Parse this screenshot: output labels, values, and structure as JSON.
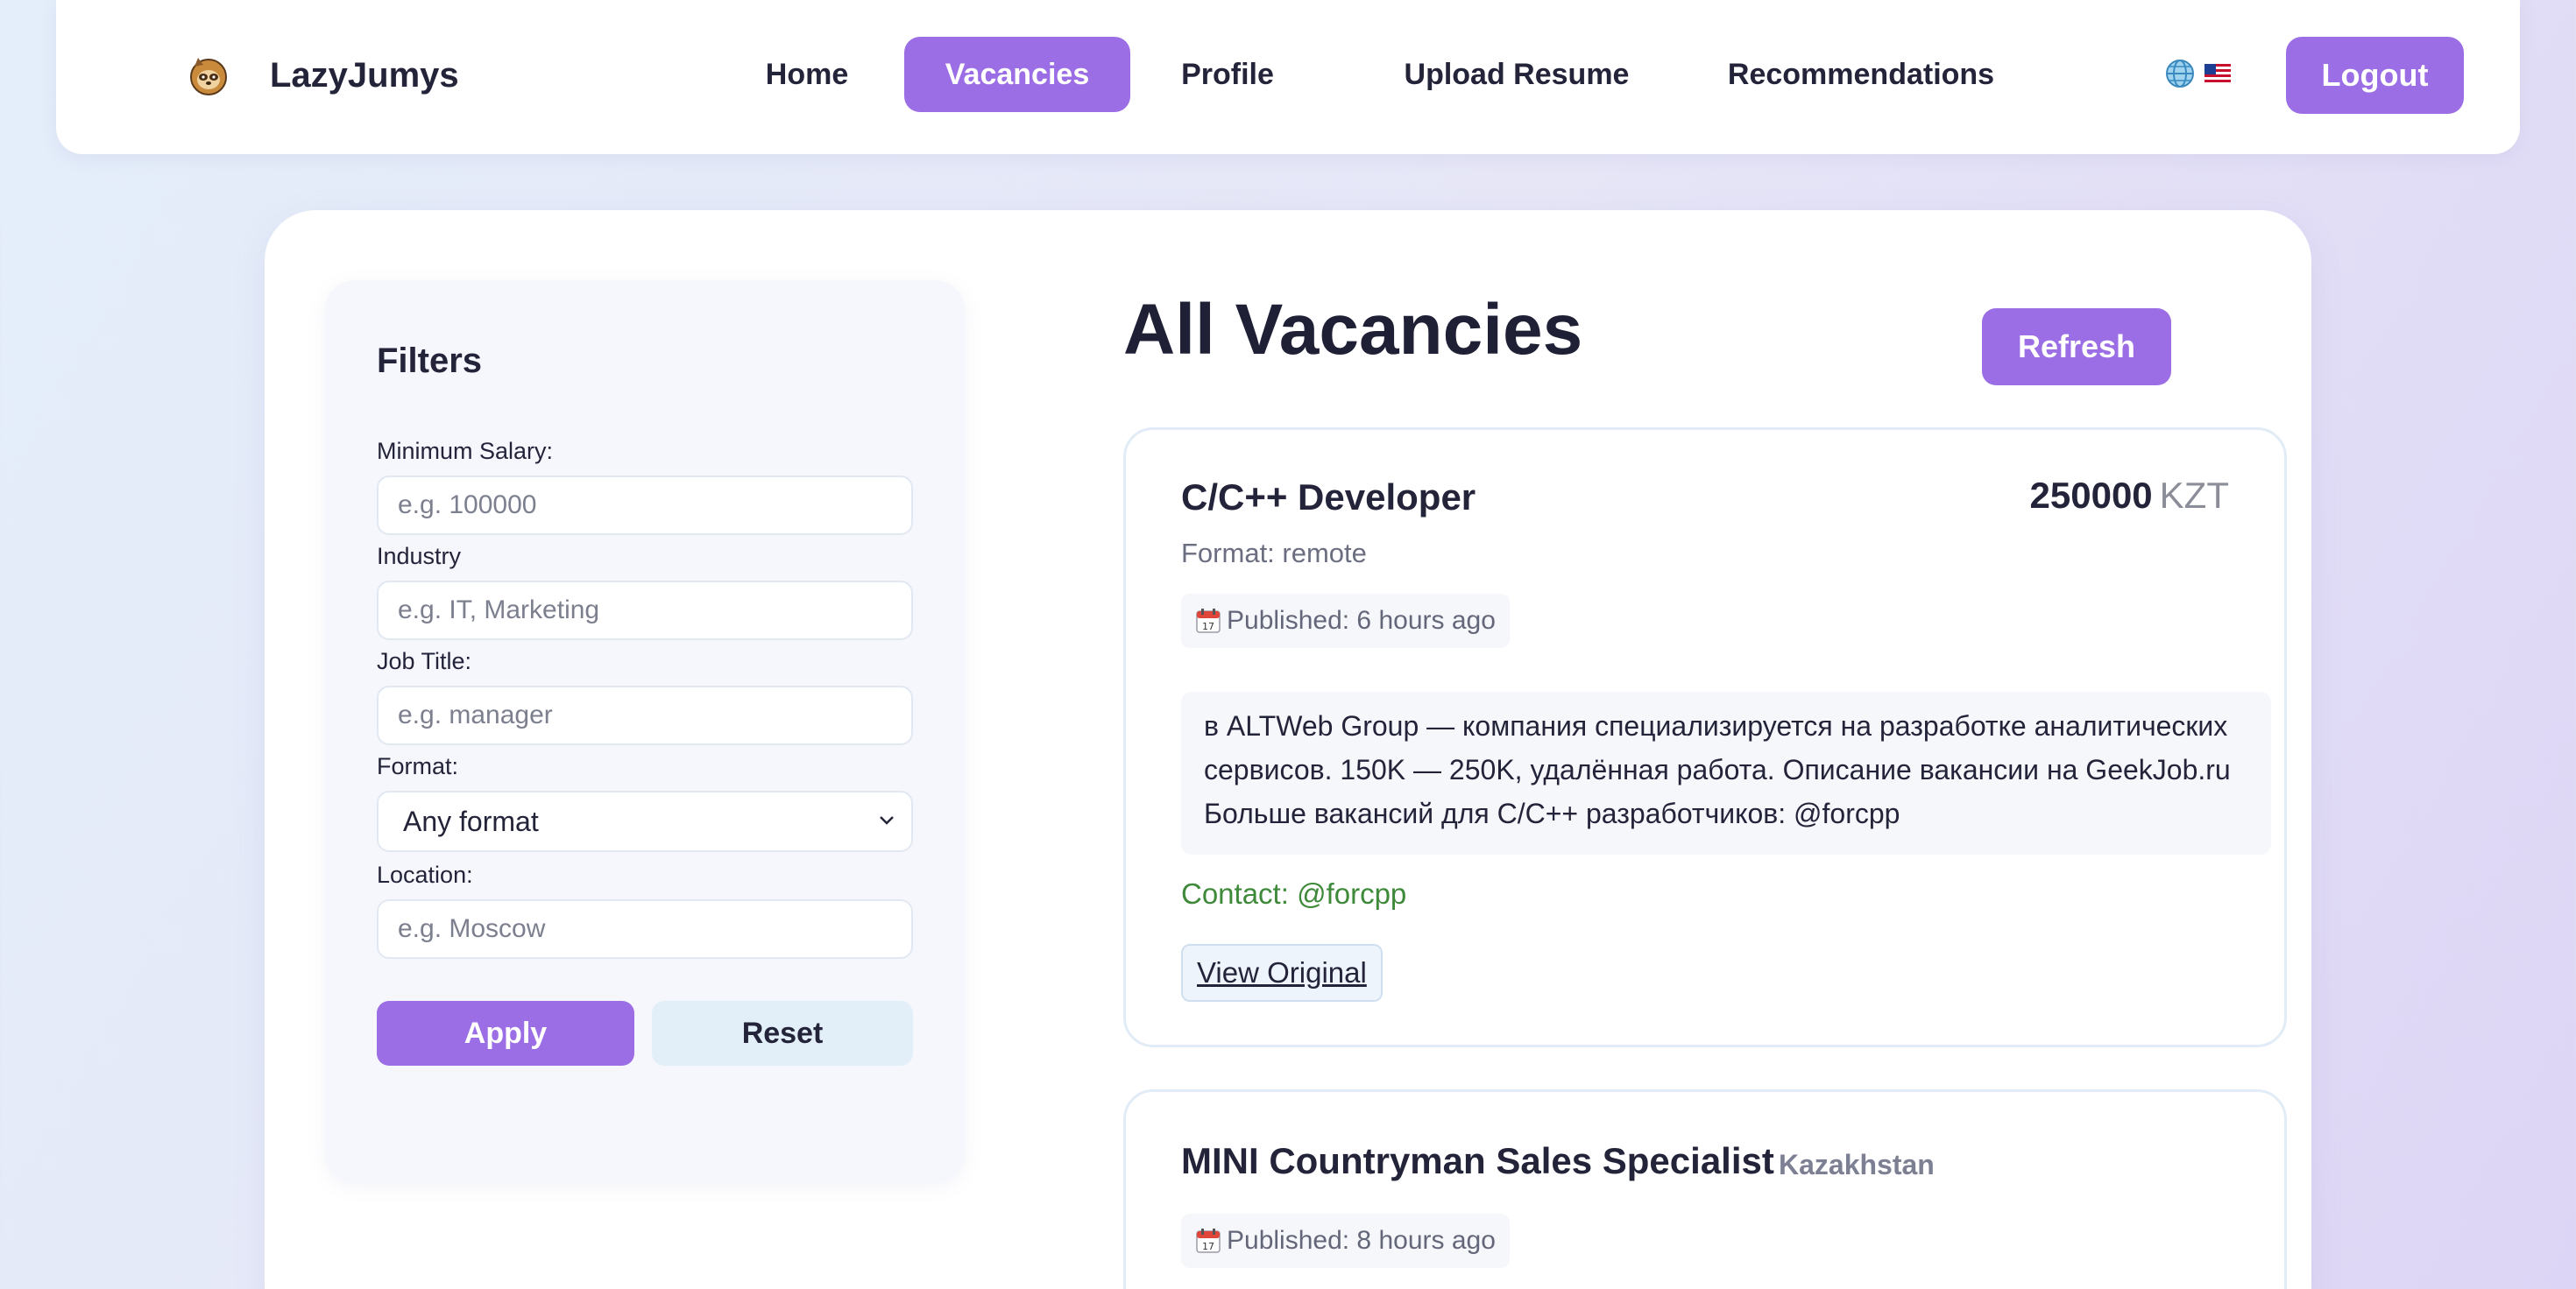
{
  "nav": {
    "brand": "LazyJumys",
    "items": [
      {
        "label": "Home",
        "active": false
      },
      {
        "label": "Vacancies",
        "active": true
      },
      {
        "label": "Profile",
        "active": false
      },
      {
        "label": "Upload Resume",
        "active": false
      },
      {
        "label": "Recommendations",
        "active": false
      }
    ],
    "logout_label": "Logout",
    "accent_color": "#9b6ee6"
  },
  "filters": {
    "title": "Filters",
    "min_salary": {
      "label": "Minimum Salary:",
      "placeholder": "e.g. 100000",
      "value": ""
    },
    "industry": {
      "label": "Industry",
      "placeholder": "e.g. IT, Marketing",
      "value": ""
    },
    "job_title": {
      "label": "Job Title:",
      "placeholder": "e.g. manager",
      "value": ""
    },
    "format": {
      "label": "Format:",
      "selected": "Any format"
    },
    "location": {
      "label": "Location:",
      "placeholder": "e.g. Moscow",
      "value": ""
    },
    "apply_label": "Apply",
    "reset_label": "Reset"
  },
  "vacancies": {
    "title": "All Vacancies",
    "refresh_label": "Refresh",
    "items": [
      {
        "title": "C/C++ Developer",
        "salary": "250000",
        "currency": "KZT",
        "format": "Format: remote",
        "published": "Published: 6 hours ago",
        "description": "в ALTWeb Group — компания специализируется на разработке аналитических сервисов. 150K — 250K, удалённая работа. Описание вакансии на GeekJob.ru Больше вакансий для C/C++ разработчиков: @forcpp",
        "contact": "Contact: @forcpp",
        "view_label": "View Original"
      },
      {
        "title": "MINI Countryman Sales Specialist",
        "location": "Kazakhstan",
        "published": "Published: 8 hours ago"
      }
    ]
  }
}
